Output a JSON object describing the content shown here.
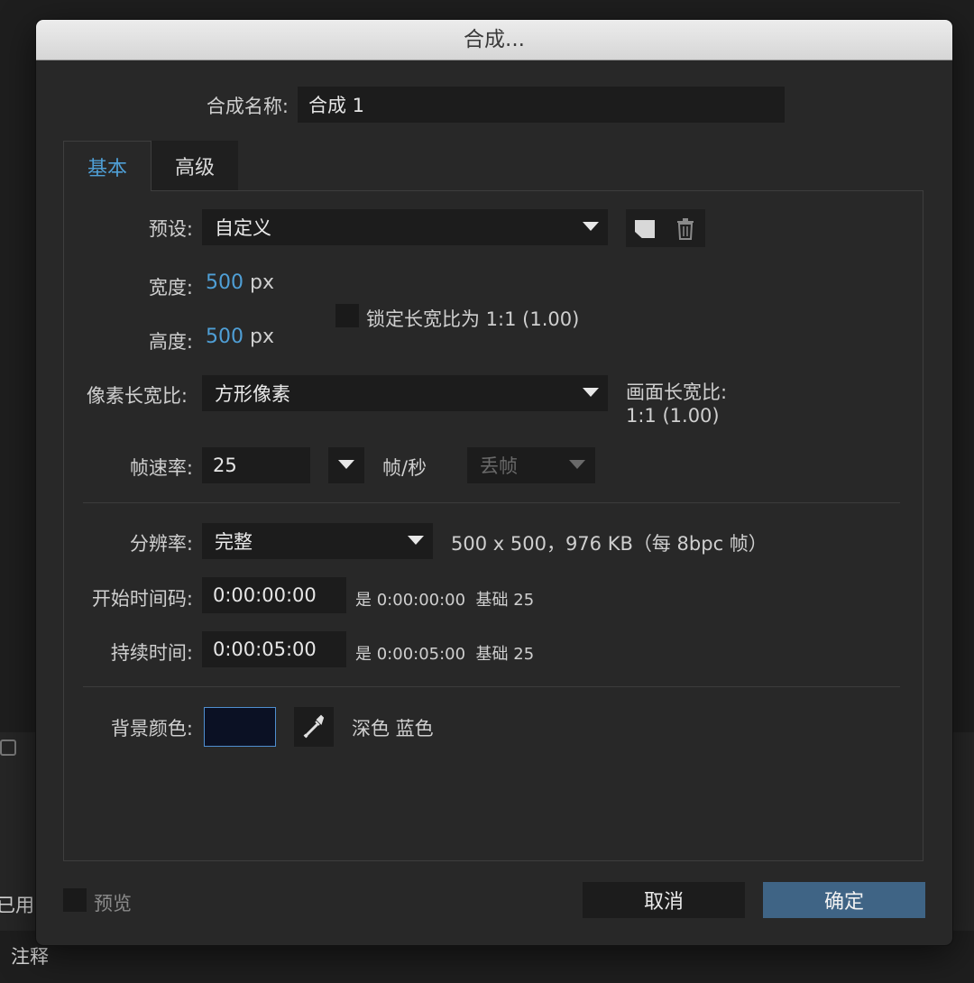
{
  "background": {
    "left_label_1": "已用",
    "left_label_2": "注释"
  },
  "dialog": {
    "title": "合成...",
    "comp_name_label": "合成名称:",
    "comp_name_value": "合成 1",
    "tabs": [
      {
        "label": "基本",
        "active": true
      },
      {
        "label": "高级",
        "active": false
      }
    ],
    "preset": {
      "label": "预设:",
      "value": "自定义"
    },
    "width": {
      "label": "宽度:",
      "value": "500",
      "unit": "px"
    },
    "height": {
      "label": "高度:",
      "value": "500",
      "unit": "px"
    },
    "lock_aspect": {
      "label": "锁定长宽比为 1:1 (1.00)",
      "checked": false
    },
    "pixel_aspect": {
      "label": "像素长宽比:",
      "value": "方形像素"
    },
    "frame_aspect": {
      "label": "画面长宽比:",
      "value": "1:1 (1.00)"
    },
    "frame_rate": {
      "label": "帧速率:",
      "value": "25",
      "unit": "帧/秒",
      "drop_frame": "丢帧"
    },
    "resolution": {
      "label": "分辨率:",
      "value": "完整",
      "info": "500 x 500，976 KB（每 8bpc 帧）"
    },
    "start_timecode": {
      "label": "开始时间码:",
      "value": "0:00:00:00",
      "info_prefix": "是 0:00:00:00",
      "info_base": "基础 25"
    },
    "duration": {
      "label": "持续时间:",
      "value": "0:00:05:00",
      "info_prefix": "是 0:00:05:00",
      "info_base": "基础 25"
    },
    "background_color": {
      "label": "背景颜色:",
      "color": "#0b1124",
      "name": "深色 蓝色"
    },
    "preview": {
      "label": "预览",
      "checked": false
    },
    "cancel_label": "取消",
    "ok_label": "确定"
  },
  "colors": {
    "accent": "#4f9fd6",
    "ok_button": "#3f6485"
  }
}
